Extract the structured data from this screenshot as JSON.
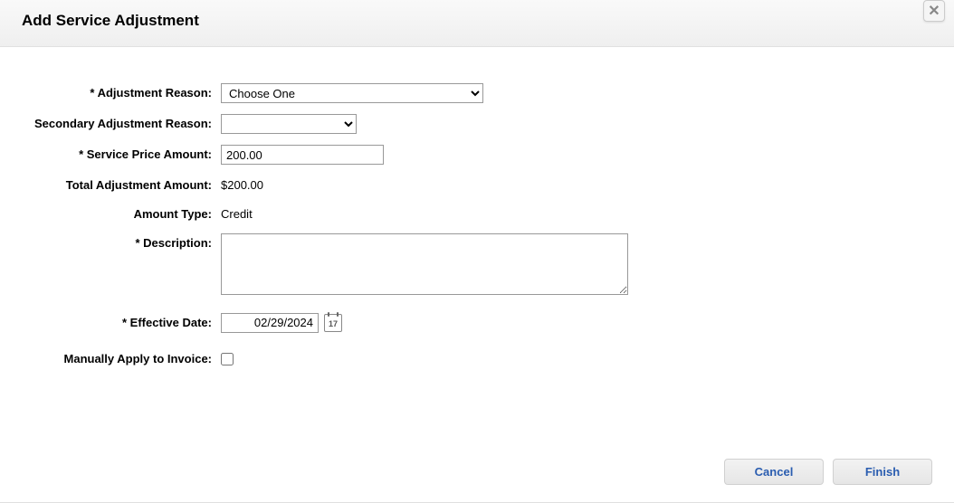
{
  "dialog": {
    "title": "Add Service Adjustment"
  },
  "form": {
    "adjustmentReason": {
      "label": "* Adjustment Reason:",
      "selected": "Choose One"
    },
    "secondaryReason": {
      "label": "Secondary Adjustment Reason:",
      "selected": ""
    },
    "servicePriceAmount": {
      "label": "* Service Price Amount:",
      "value": "200.00"
    },
    "totalAdjustmentAmount": {
      "label": "Total Adjustment Amount:",
      "value": "$200.00"
    },
    "amountType": {
      "label": "Amount Type:",
      "value": "Credit"
    },
    "description": {
      "label": "* Description:",
      "value": ""
    },
    "effectiveDate": {
      "label": "* Effective Date:",
      "value": "02/29/2024",
      "iconDay": "17"
    },
    "manuallyApply": {
      "label": "Manually Apply to Invoice:",
      "checked": false
    }
  },
  "buttons": {
    "cancel": "Cancel",
    "finish": "Finish"
  }
}
